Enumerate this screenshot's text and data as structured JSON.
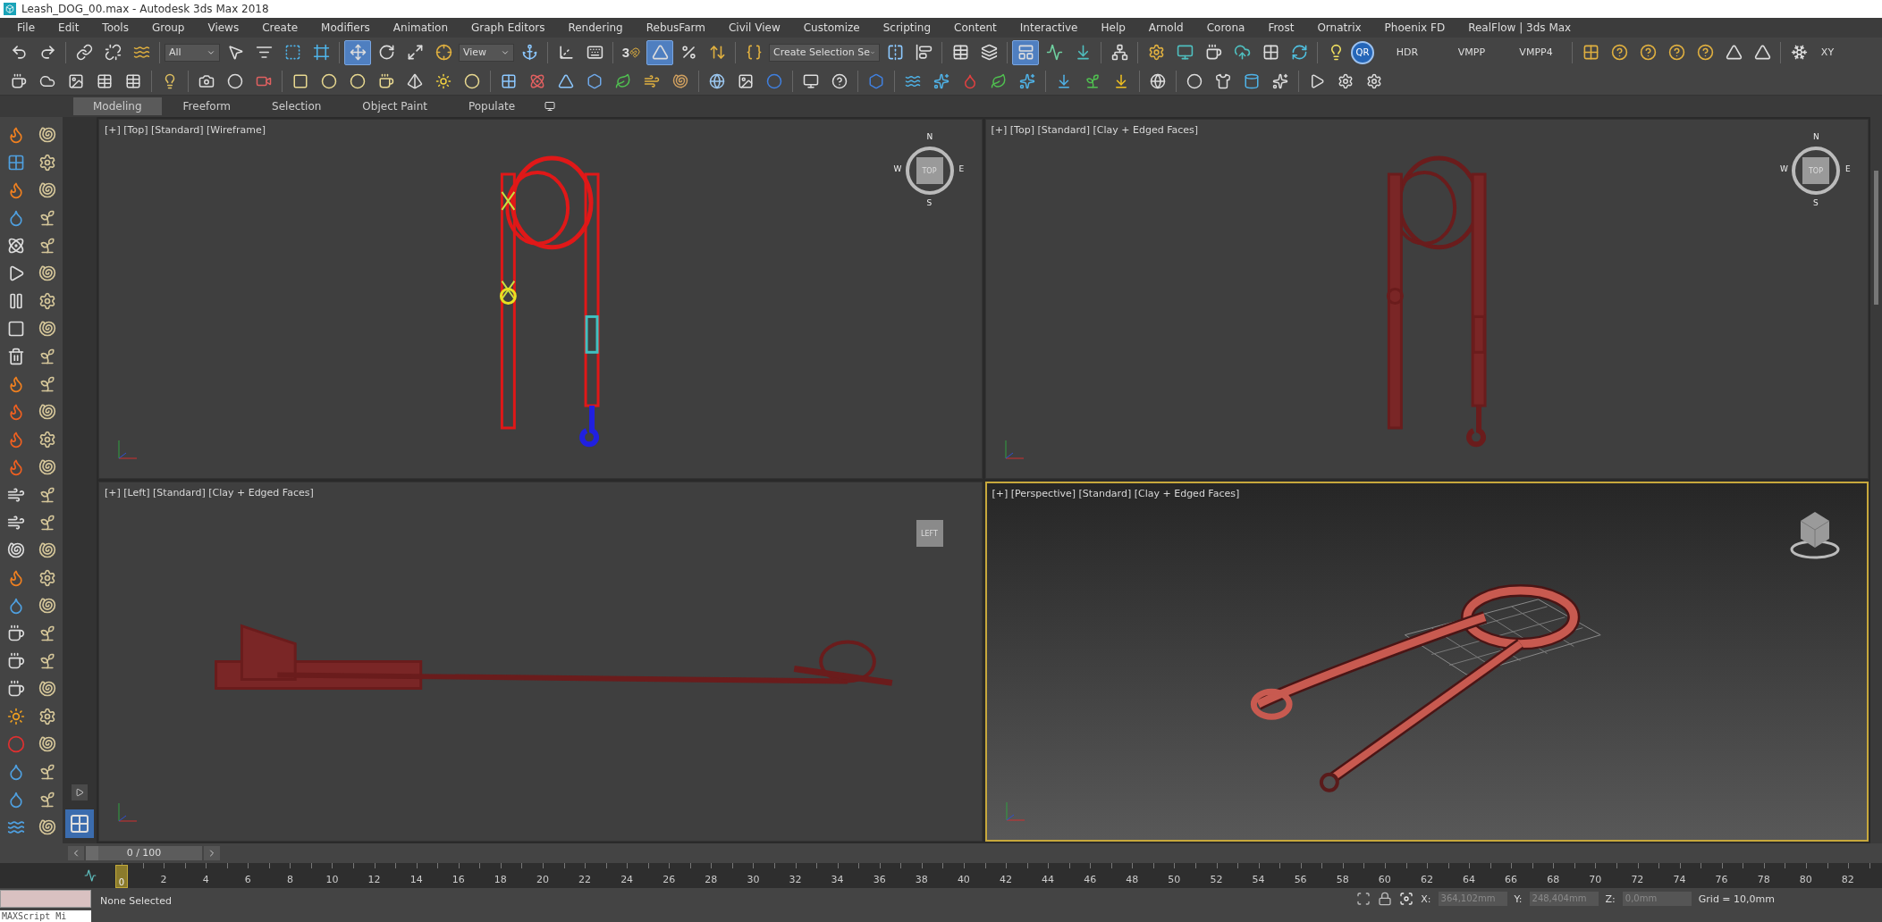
{
  "window": {
    "title": "Leash_DOG_00.max - Autodesk 3ds Max 2018"
  },
  "menu": [
    "File",
    "Edit",
    "Tools",
    "Group",
    "Views",
    "Create",
    "Modifiers",
    "Animation",
    "Graph Editors",
    "Rendering",
    "RebusFarm",
    "Civil View",
    "Customize",
    "Scripting",
    "Content",
    "Interactive",
    "Help",
    "Arnold",
    "Corona",
    "Frost",
    "Ornatrix",
    "Phoenix FD",
    "RealFlow | 3ds Max"
  ],
  "main_toolbar": [
    {
      "kind": "undo",
      "selected": false
    },
    {
      "kind": "redo",
      "selected": false
    },
    {
      "kind": "sep"
    },
    {
      "kind": "link",
      "selected": false
    },
    {
      "kind": "unlink",
      "selected": false
    },
    {
      "kind": "bind",
      "selected": false
    },
    {
      "kind": "sep"
    },
    {
      "kind": "dropdown",
      "label": "All"
    },
    {
      "kind": "select",
      "selected": false
    },
    {
      "kind": "select-name",
      "selected": false
    },
    {
      "kind": "rect-region",
      "selected": false
    },
    {
      "kind": "window-crossing",
      "selected": false
    },
    {
      "kind": "sep"
    },
    {
      "kind": "move",
      "selected": true
    },
    {
      "kind": "rotate",
      "selected": false
    },
    {
      "kind": "scale",
      "selected": false
    },
    {
      "kind": "place",
      "selected": false
    },
    {
      "kind": "dropdown",
      "label": "View"
    },
    {
      "kind": "pivot",
      "selected": false
    },
    {
      "kind": "sep"
    },
    {
      "kind": "axis",
      "selected": false
    },
    {
      "kind": "keyboard",
      "selected": false
    },
    {
      "kind": "sep"
    },
    {
      "kind": "snap",
      "label": "3",
      "selected": false
    },
    {
      "kind": "angle-snap",
      "selected": true
    },
    {
      "kind": "percent-snap",
      "selected": false
    },
    {
      "kind": "spinner-snap",
      "selected": false
    },
    {
      "kind": "sep"
    },
    {
      "kind": "edit-sets",
      "selected": false
    },
    {
      "kind": "dropdown",
      "label": "Create Selection Se"
    },
    {
      "kind": "mirror",
      "selected": false
    },
    {
      "kind": "align",
      "selected": false
    },
    {
      "kind": "sep"
    },
    {
      "kind": "explorer",
      "selected": false
    },
    {
      "kind": "layers",
      "selected": false
    },
    {
      "kind": "sep"
    },
    {
      "kind": "ribbon",
      "selected": true
    },
    {
      "kind": "curve-editor",
      "selected": false
    },
    {
      "kind": "dope",
      "selected": false
    },
    {
      "kind": "sep"
    },
    {
      "kind": "schematic",
      "selected": false
    },
    {
      "kind": "sep"
    },
    {
      "kind": "material",
      "selected": false
    },
    {
      "kind": "frame-window",
      "selected": false
    },
    {
      "kind": "render",
      "selected": false
    },
    {
      "kind": "render-cloud",
      "selected": false
    },
    {
      "kind": "grid",
      "selected": false
    },
    {
      "kind": "cycle",
      "selected": false
    },
    {
      "kind": "sep"
    },
    {
      "kind": "light",
      "selected": false
    },
    {
      "kind": "badge",
      "label": "QR"
    },
    {
      "kind": "text",
      "label": "HDR"
    },
    {
      "kind": "text",
      "label": "VMPP"
    },
    {
      "kind": "text",
      "label": "VMPP4"
    },
    {
      "kind": "sep"
    },
    {
      "kind": "helper-grid",
      "selected": false
    },
    {
      "kind": "helper-axis",
      "selected": false
    },
    {
      "kind": "helper-point",
      "selected": false
    },
    {
      "kind": "helper-line",
      "selected": false
    },
    {
      "kind": "helper-line2",
      "selected": false
    },
    {
      "kind": "helper-tri",
      "selected": false
    },
    {
      "kind": "helper-tri2",
      "selected": false
    },
    {
      "kind": "sep"
    },
    {
      "kind": "snowflake",
      "selected": false
    },
    {
      "kind": "text",
      "label": "XY"
    }
  ],
  "ribbon_tabs": [
    {
      "label": "Modeling",
      "selected": true
    },
    {
      "label": "Freeform",
      "selected": false
    },
    {
      "label": "Selection",
      "selected": false
    },
    {
      "label": "Object Paint",
      "selected": false
    },
    {
      "label": "Populate",
      "selected": false
    }
  ],
  "viewports": [
    {
      "label": "[+] [Top] [Standard] [Wireframe]",
      "kind": "topwire",
      "active": false,
      "viewcube": {
        "face": "TOP",
        "compass": [
          "N",
          "E",
          "S",
          "W"
        ]
      }
    },
    {
      "label": "[+] [Top] [Standard] [Clay + Edged Faces]",
      "kind": "topclay",
      "active": false,
      "viewcube": {
        "face": "TOP",
        "compass": [
          "N",
          "E",
          "S",
          "W"
        ]
      }
    },
    {
      "label": "[+] [Left] [Standard] [Clay + Edged Faces]",
      "kind": "side",
      "active": false,
      "viewcube": {
        "face": "LEFT"
      }
    },
    {
      "label": "[+] [Perspective] [Standard] [Clay + Edged Faces]",
      "kind": "perspective",
      "active": true
    }
  ],
  "time_slider": {
    "position": "0 / 100",
    "level": 0
  },
  "timeline": {
    "current_frame": "0",
    "ticks": [
      "2",
      "4",
      "6",
      "8",
      "10",
      "12",
      "14",
      "16",
      "18",
      "20",
      "22",
      "24",
      "26",
      "28",
      "30",
      "32",
      "34",
      "36",
      "38",
      "40",
      "42",
      "44",
      "46",
      "48",
      "50",
      "52",
      "54",
      "56",
      "58",
      "60",
      "62",
      "64",
      "66",
      "68",
      "70",
      "72",
      "74",
      "76",
      "78",
      "80",
      "82"
    ]
  },
  "status": {
    "maxscript": "MAXScript Mi",
    "selection": "None Selected",
    "x_label": "X:",
    "x": "364,102mm",
    "y_label": "Y:",
    "y": "248,404mm",
    "z_label": "Z:",
    "z": "0,0mm",
    "grid": "Grid = 10,0mm"
  }
}
